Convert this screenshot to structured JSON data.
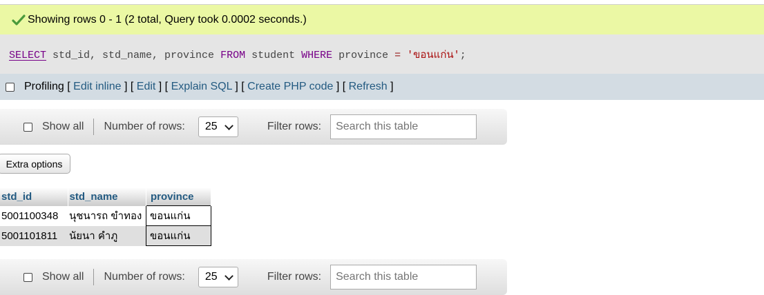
{
  "success_message": "Showing rows 0 - 1 (2 total, Query took 0.0002 seconds.)",
  "sql": {
    "select": "SELECT",
    "cols": " std_id, std_name, province ",
    "from": "FROM",
    "table": " student ",
    "where": "WHERE",
    "field": " province ",
    "eq": "=",
    "space": " ",
    "value": "'ขอนแก่น'",
    "end": ";"
  },
  "profiling": {
    "label": "Profiling",
    "open1": " [ ",
    "edit_inline": "Edit inline",
    "mid1": " ] [ ",
    "edit": "Edit",
    "mid2": " ] [ ",
    "explain": "Explain SQL",
    "mid3": " ] [ ",
    "php": "Create PHP code",
    "mid4": " ] [ ",
    "refresh": "Refresh",
    "close": " ]"
  },
  "nav": {
    "show_all": "Show all",
    "number_of_rows": "Number of rows:",
    "rows_value": "25",
    "filter_rows": "Filter rows:",
    "search_placeholder": "Search this table"
  },
  "extra_options": "Extra options",
  "table": {
    "headers": [
      "std_id",
      "std_name",
      "province"
    ],
    "rows": [
      [
        "5001100348",
        "นุชนารถ ขำทอง",
        "ขอนแก่น"
      ],
      [
        "5001101811",
        "นัยนา คำภู",
        "ขอนแก่น"
      ]
    ]
  },
  "colors": {
    "success_bg": "#ebf8a4",
    "link": "#235a81",
    "profiling_bg": "#d3dce3",
    "check": "#4a9a3b"
  }
}
